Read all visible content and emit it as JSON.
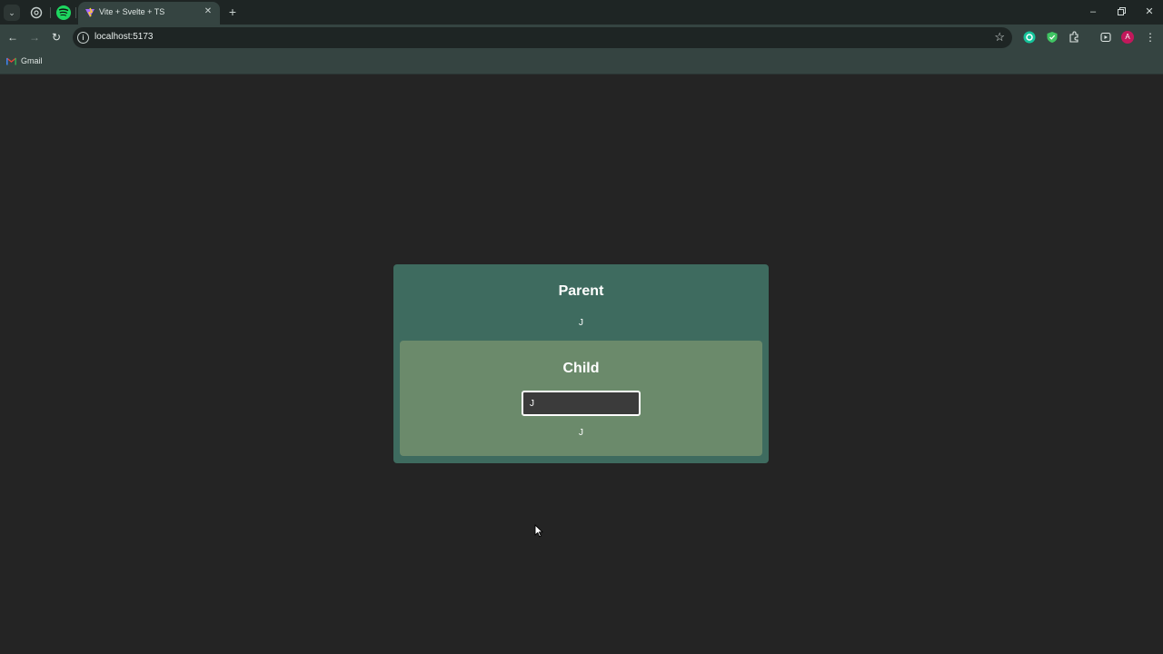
{
  "browser": {
    "tab_title": "Vite + Svelte + TS",
    "address_url": "localhost:5173",
    "bookmarks": [
      {
        "label": "Gmail"
      }
    ],
    "profile_initial": "A"
  },
  "colors": {
    "page_background": "#242424",
    "parent_card": "#3e6b5f",
    "child_card": "#6b8a6b",
    "browser_toolbar": "#354441"
  },
  "icons": [
    "tab-search-icon",
    "chatgpt-icon",
    "spotify-icon",
    "svelte-favicon-icon",
    "close-icon",
    "plus-icon",
    "minimize-icon",
    "restore-icon",
    "back-icon",
    "forward-icon",
    "reload-icon",
    "site-info-icon",
    "star-icon",
    "grammarly-icon",
    "shield-icon",
    "extensions-icon",
    "media-icon",
    "more-icon",
    "gmail-icon",
    "mouse-pointer-icon"
  ],
  "app": {
    "parent": {
      "title": "Parent",
      "value": "J"
    },
    "child": {
      "title": "Child",
      "input_value": "J",
      "value": "J"
    }
  }
}
